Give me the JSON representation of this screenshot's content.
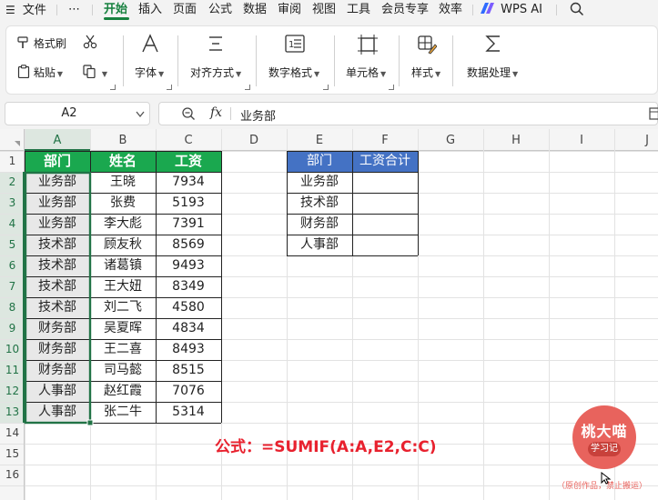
{
  "menubar": {
    "file": "文件",
    "more": "⋯",
    "tabs": [
      "开始",
      "插入",
      "页面",
      "公式",
      "数据",
      "审阅",
      "视图",
      "工具",
      "会员专享",
      "效率"
    ],
    "wps_ai": "WPS AI"
  },
  "ribbon": {
    "format_painter": "格式刷",
    "paste": "粘贴",
    "font": "字体",
    "alignment": "对齐方式",
    "number_format": "数字格式",
    "cells": "单元格",
    "styles": "样式",
    "data_processing": "数据处理"
  },
  "formula_bar": {
    "name_box": "A2",
    "fx": "fx",
    "content": "业务部"
  },
  "sheet": {
    "columns": [
      "A",
      "B",
      "C",
      "D",
      "E",
      "F",
      "G",
      "H",
      "I",
      "J"
    ],
    "rows": [
      "1",
      "2",
      "3",
      "4",
      "5",
      "6",
      "7",
      "8",
      "9",
      "10",
      "11",
      "12",
      "13",
      "14",
      "15",
      "16"
    ],
    "headers": [
      "部门",
      "姓名",
      "工资"
    ],
    "data": [
      [
        "业务部",
        "王晓",
        "7934"
      ],
      [
        "业务部",
        "张费",
        "5193"
      ],
      [
        "业务部",
        "李大彪",
        "7391"
      ],
      [
        "技术部",
        "顾友秋",
        "8569"
      ],
      [
        "技术部",
        "诸葛镇",
        "9493"
      ],
      [
        "技术部",
        "王大妞",
        "8349"
      ],
      [
        "技术部",
        "刘二飞",
        "4580"
      ],
      [
        "财务部",
        "吴夏晖",
        "4834"
      ],
      [
        "财务部",
        "王二喜",
        "8493"
      ],
      [
        "财务部",
        "司马懿",
        "8515"
      ],
      [
        "人事部",
        "赵红霞",
        "7076"
      ],
      [
        "人事部",
        "张二牛",
        "5314"
      ]
    ],
    "summary_headers": [
      "部门",
      "工资合计"
    ],
    "summary_depts": [
      "业务部",
      "技术部",
      "财务部",
      "人事部"
    ]
  },
  "note": {
    "formula": "公式：=SUMIF(A:A,E2,C:C)"
  },
  "watermark": {
    "name": "桃大喵",
    "sub": "学习记",
    "copyright": "（原创作品，禁止搬运）"
  },
  "colors": {
    "accent_green": "#17813f",
    "header_green": "#1aa84f",
    "summary_blue": "#4472c4",
    "selection_border": "#217346",
    "note_red": "#e8212e",
    "logo_red": "#e8635d"
  }
}
